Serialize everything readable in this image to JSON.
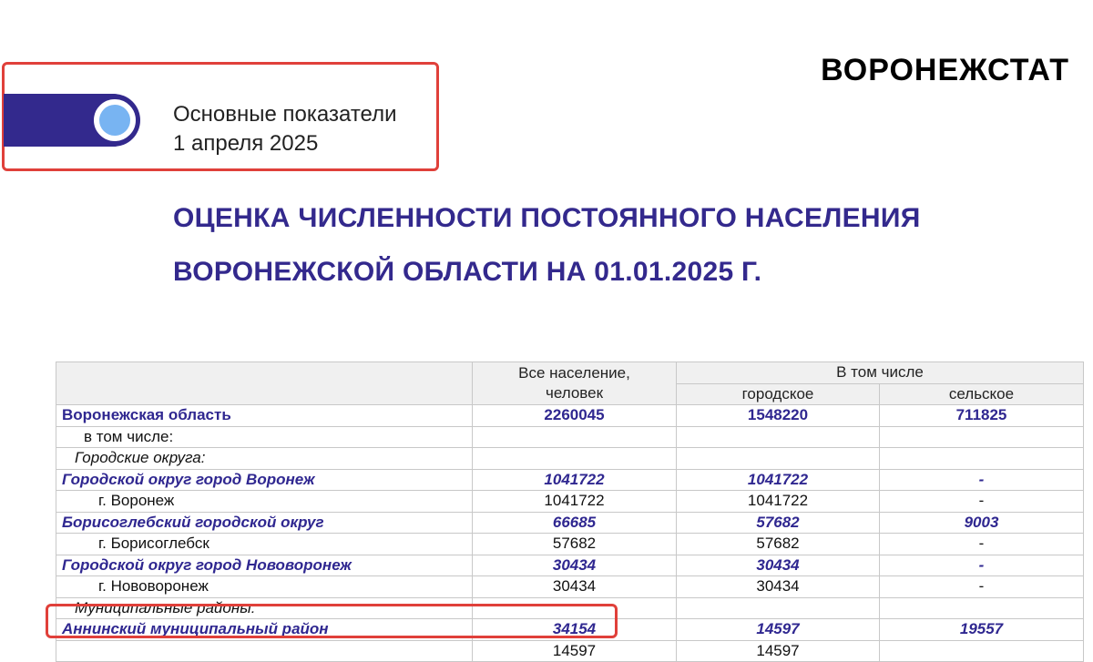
{
  "brand": "ВОРОНЕЖСТАТ",
  "header": {
    "line1": "Основные показатели",
    "line2": "1 апреля 2025"
  },
  "title": {
    "line1": "ОЦЕНКА ЧИСЛЕННОСТИ ПОСТОЯННОГО НАСЕЛЕНИЯ",
    "line2": "ВОРОНЕЖСКОЙ ОБЛАСТИ НА 01.01.2025 Г."
  },
  "table": {
    "headers": {
      "total": "Все население,",
      "total_unit": "человек",
      "group": "В том числе",
      "urban": "городское",
      "rural": "сельское"
    },
    "rows": [
      {
        "name": "Воронежская область",
        "total": "2260045",
        "urban": "1548220",
        "rural": "711825"
      },
      {
        "name": "в том числе:",
        "total": "",
        "urban": "",
        "rural": ""
      },
      {
        "name": "Городские округа:",
        "total": "",
        "urban": "",
        "rural": ""
      },
      {
        "name": "Городской округ город Воронеж",
        "total": "1041722",
        "urban": "1041722",
        "rural": "-"
      },
      {
        "name": "г. Воронеж",
        "total": "1041722",
        "urban": "1041722",
        "rural": "-"
      },
      {
        "name": "Борисоглебский городской округ",
        "total": "66685",
        "urban": "57682",
        "rural": "9003"
      },
      {
        "name": "г. Борисоглебск",
        "total": "57682",
        "urban": "57682",
        "rural": "-"
      },
      {
        "name": "Городской округ город Нововоронеж",
        "total": "30434",
        "urban": "30434",
        "rural": "-"
      },
      {
        "name": "г. Нововоронеж",
        "total": "30434",
        "urban": "30434",
        "rural": "-"
      },
      {
        "name": "Муниципальные районы:",
        "total": "",
        "urban": "",
        "rural": ""
      },
      {
        "name": "Аннинский муниципальный район",
        "total": "34154",
        "urban": "14597",
        "rural": "19557"
      },
      {
        "name": "",
        "total": "14597",
        "urban": "14597",
        "rural": ""
      }
    ]
  }
}
